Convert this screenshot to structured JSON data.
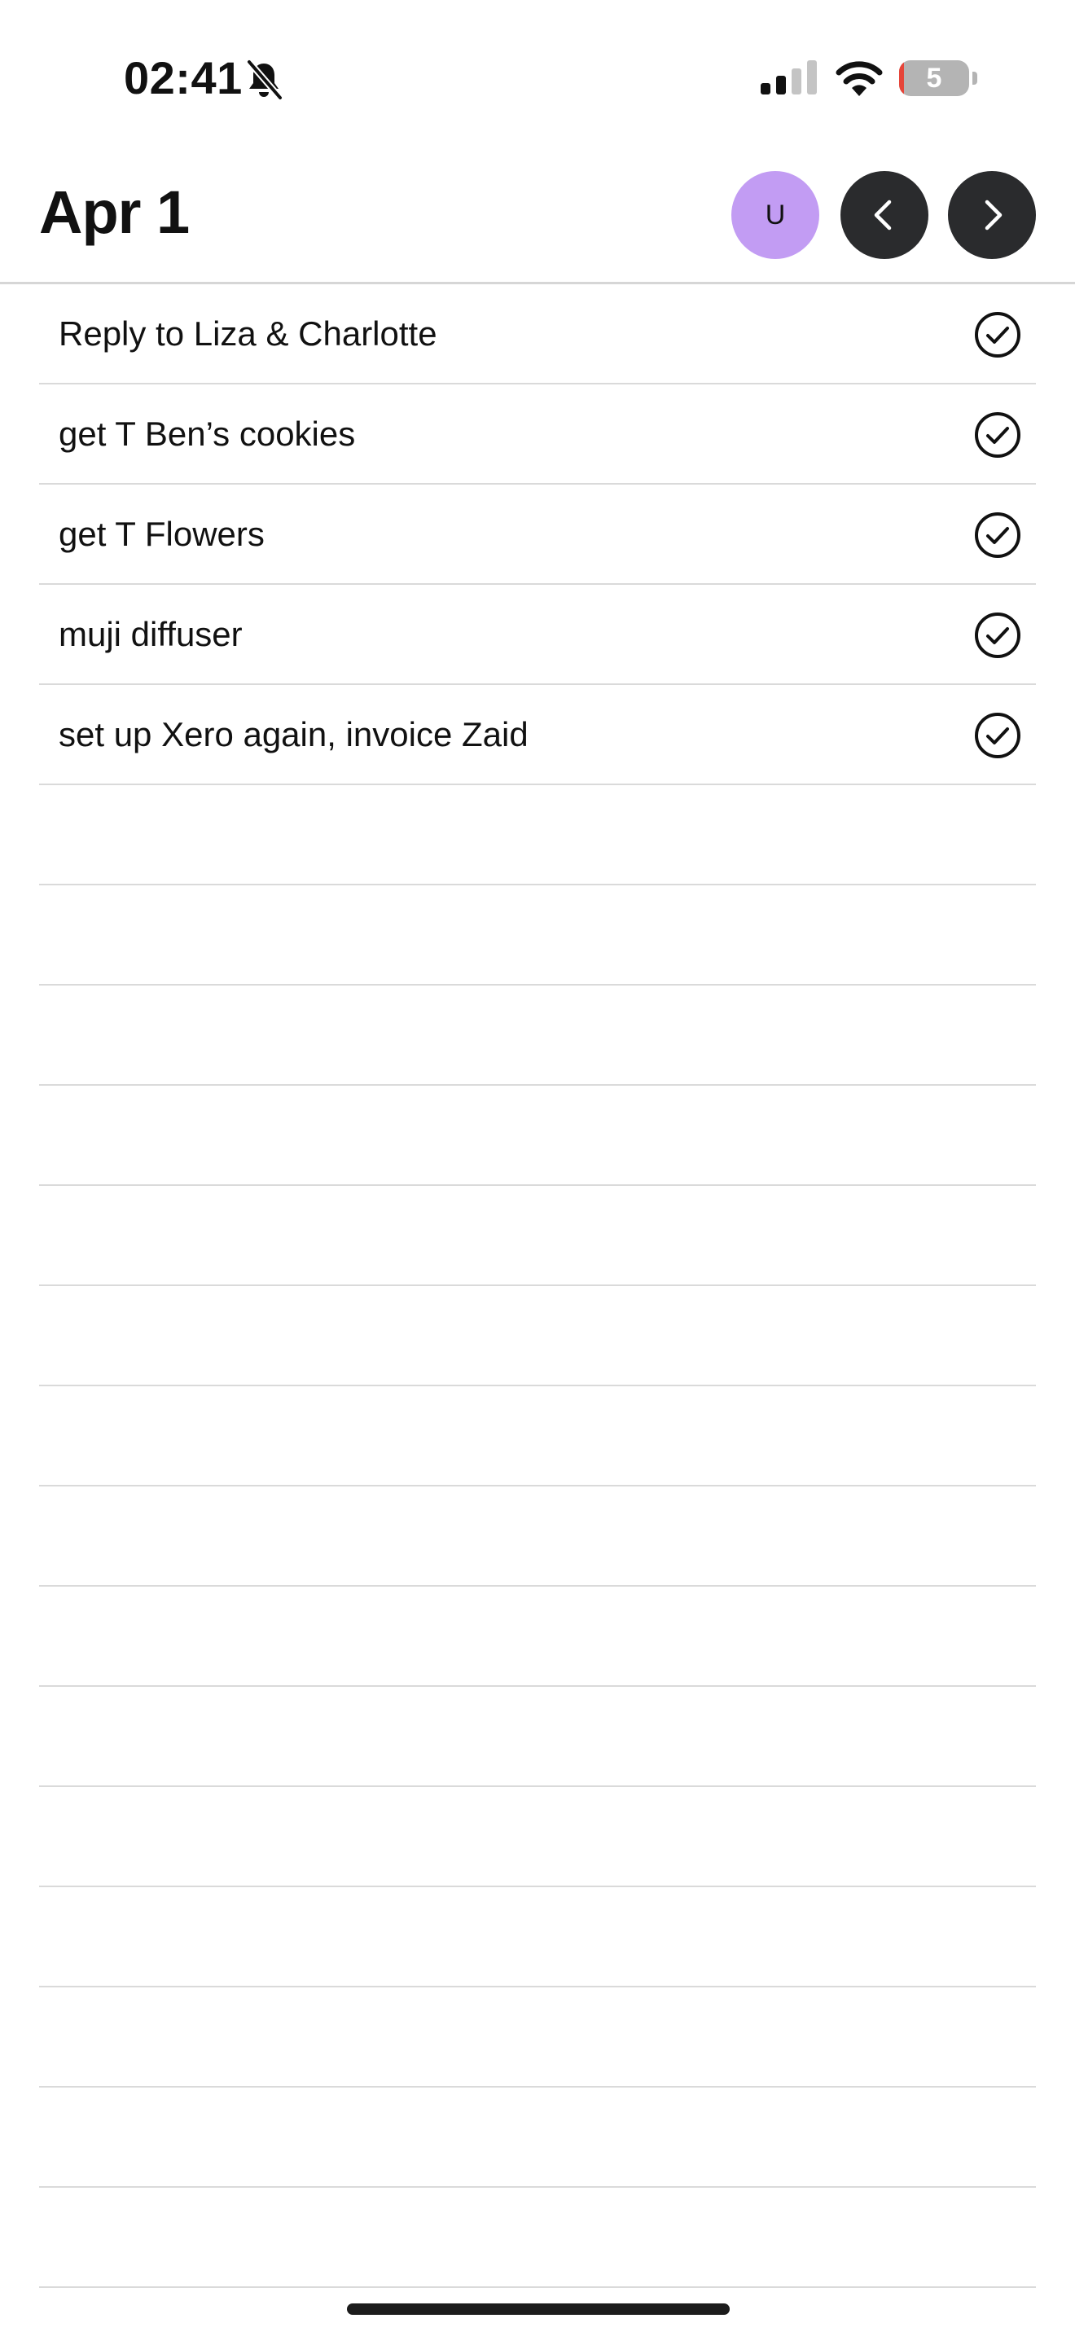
{
  "status_bar": {
    "time": "02:41",
    "battery_level": "5",
    "battery_fraction": 0.05,
    "icons": [
      "bell-slash-icon",
      "cellular-signal-icon",
      "wifi-icon",
      "battery-icon"
    ]
  },
  "header": {
    "title": "Apr 1",
    "avatar_initial": "U",
    "avatar_color": "#c29cf3",
    "nav_button_color": "#2a2b2d",
    "prev_icon": "chevron-left-icon",
    "next_icon": "chevron-right-icon"
  },
  "tasks": [
    {
      "text": "Reply to Liza & Charlotte"
    },
    {
      "text": "get T Ben’s cookies"
    },
    {
      "text": "get T Flowers"
    },
    {
      "text": "muji diffuser"
    },
    {
      "text": "set up Xero again, invoice Zaid"
    },
    {
      "text": ""
    },
    {
      "text": ""
    },
    {
      "text": ""
    },
    {
      "text": ""
    },
    {
      "text": ""
    },
    {
      "text": ""
    },
    {
      "text": ""
    },
    {
      "text": ""
    },
    {
      "text": ""
    },
    {
      "text": ""
    },
    {
      "text": ""
    },
    {
      "text": ""
    },
    {
      "text": ""
    },
    {
      "text": ""
    },
    {
      "text": ""
    }
  ]
}
